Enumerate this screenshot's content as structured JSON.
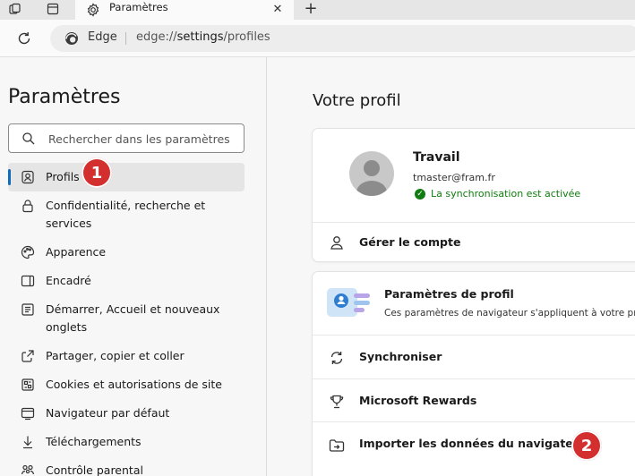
{
  "browser": {
    "tab_title": "Paramètres",
    "tab_close": "✕",
    "new_tab": "+",
    "omnibox_label": "Edge",
    "url_prefix": "edge://",
    "url_bold": "settings",
    "url_suffix": "/profiles"
  },
  "sidebar": {
    "title": "Paramètres",
    "search_placeholder": "Rechercher dans les paramètres",
    "items": [
      {
        "label": "Profils",
        "icon": "profile-icon"
      },
      {
        "label": "Confidentialité, recherche et services",
        "icon": "lock-icon"
      },
      {
        "label": "Apparence",
        "icon": "palette-icon"
      },
      {
        "label": "Encadré",
        "icon": "sidebar-icon"
      },
      {
        "label": "Démarrer, Accueil et nouveaux onglets",
        "icon": "home-icon"
      },
      {
        "label": "Partager, copier et coller",
        "icon": "share-icon"
      },
      {
        "label": "Cookies et autorisations de site",
        "icon": "cookie-icon"
      },
      {
        "label": "Navigateur par défaut",
        "icon": "browser-icon"
      },
      {
        "label": "Téléchargements",
        "icon": "download-icon"
      },
      {
        "label": "Contrôle parental",
        "icon": "family-icon"
      }
    ]
  },
  "annotations": {
    "badge1": "1",
    "badge2": "2"
  },
  "main": {
    "title": "Votre profil",
    "profile": {
      "name": "Travail",
      "email": "tmaster@fram.fr",
      "sync_status": "La synchronisation est activée",
      "manage_label": "Gérer le compte"
    },
    "profile_settings": {
      "title": "Paramètres de profil",
      "description": "Ces paramètres de navigateur s'appliquent à votre pr"
    },
    "rows": [
      {
        "label": "Synchroniser",
        "icon": "sync-icon"
      },
      {
        "label": "Microsoft Rewards",
        "icon": "trophy-icon"
      },
      {
        "label": "Importer les données du navigateur",
        "icon": "folder-import-icon"
      }
    ]
  },
  "colors": {
    "accent": "#0f6cbd",
    "badge": "#d32f2f",
    "sync_ok": "#107c10"
  }
}
